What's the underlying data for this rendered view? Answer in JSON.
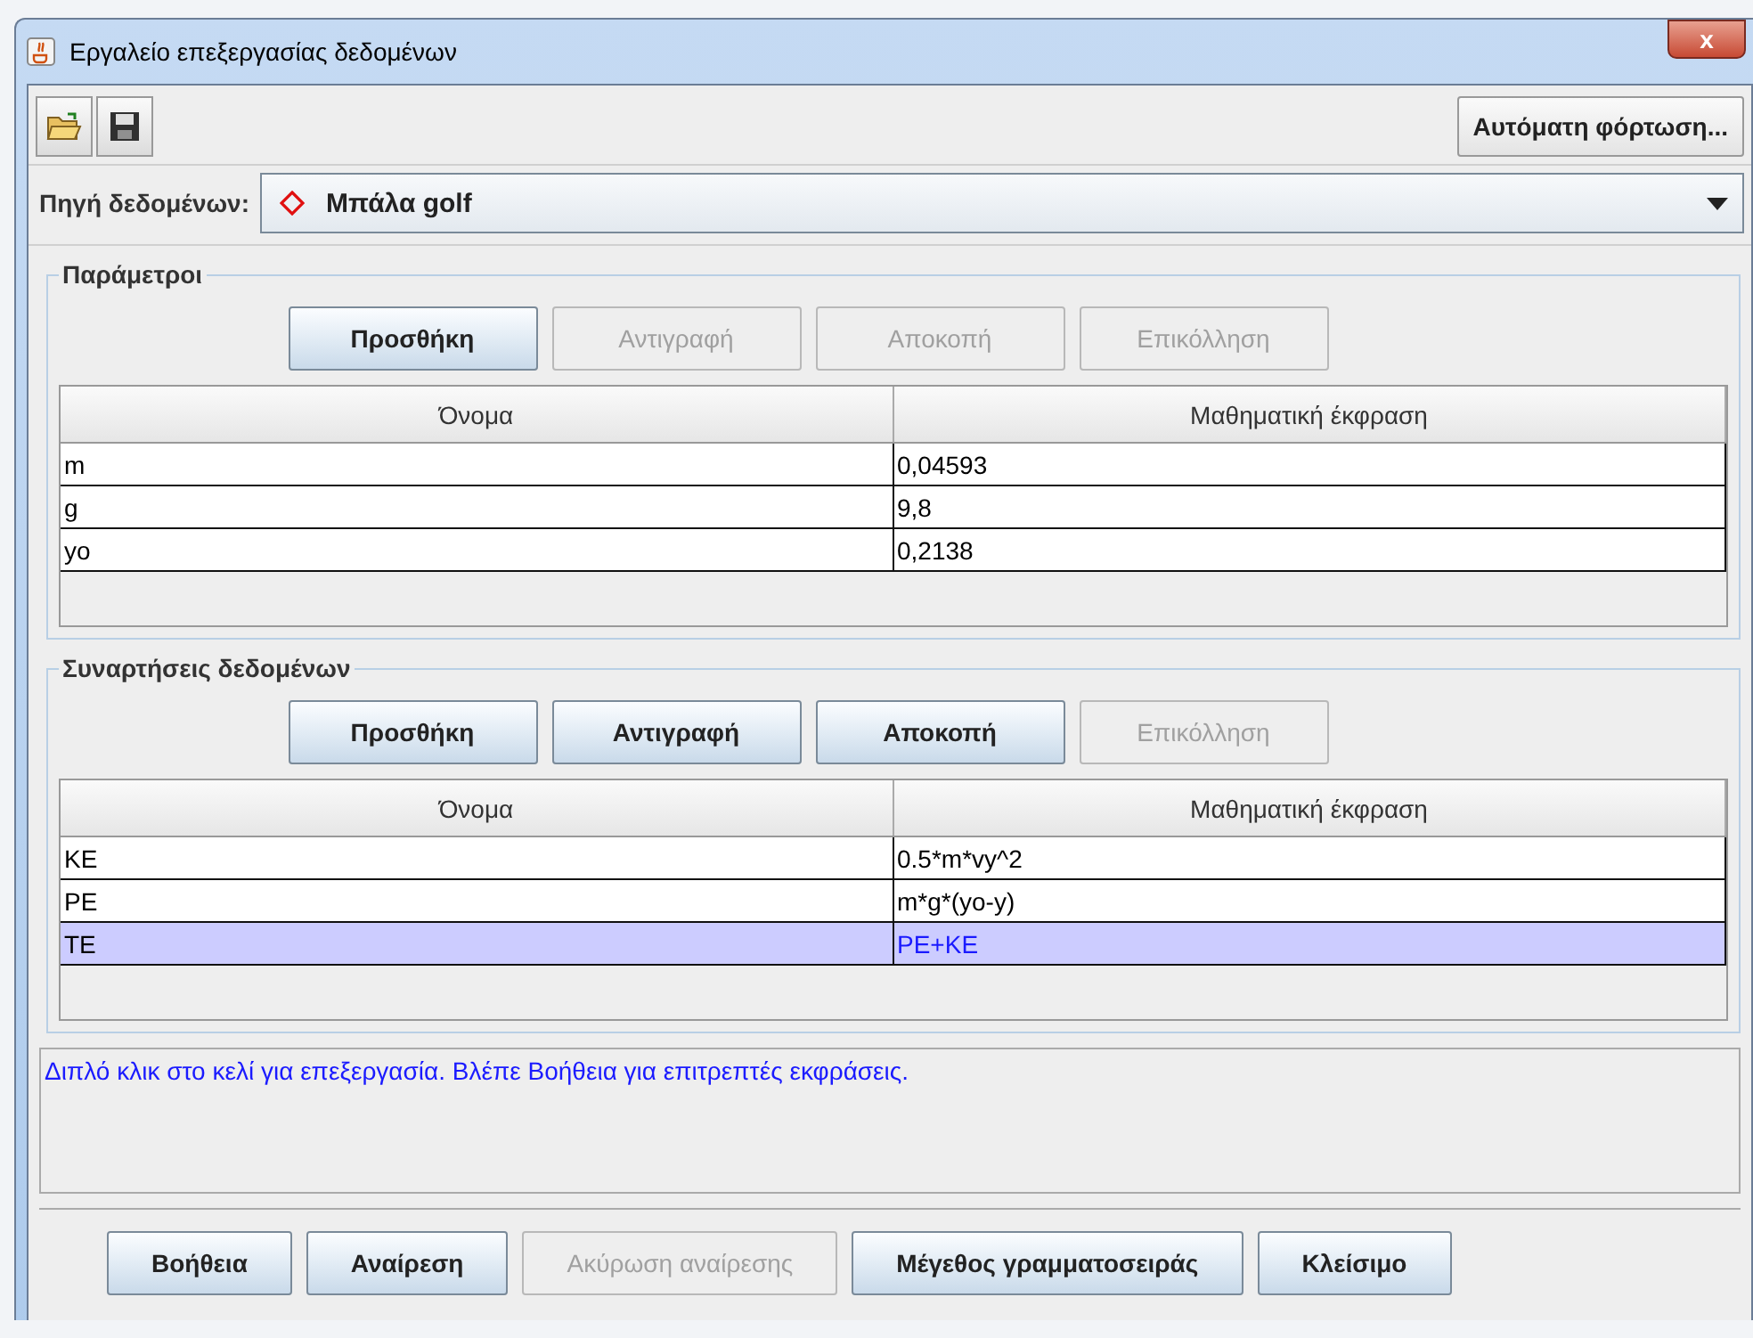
{
  "window": {
    "title": "Εργαλείο επεξεργασίας δεδομένων",
    "close": "x"
  },
  "auto_load_button": "Αυτόματη φόρτωση...",
  "data_source": {
    "label": "Πηγή δεδομένων:",
    "value": "Μπάλα golf"
  },
  "sections": [
    {
      "title": "Παράμετροι",
      "buttons": [
        {
          "label": "Προσθήκη",
          "disabled": false
        },
        {
          "label": "Αντιγραφή",
          "disabled": true
        },
        {
          "label": "Αποκοπή",
          "disabled": true
        },
        {
          "label": "Επικόλληση",
          "disabled": true
        }
      ],
      "columns": [
        "Όνομα",
        "Μαθηματική έκφραση"
      ],
      "rows": [
        {
          "cells": [
            "m",
            "0,04593"
          ],
          "selected": false
        },
        {
          "cells": [
            "g",
            "9,8"
          ],
          "selected": false
        },
        {
          "cells": [
            "yo",
            "0,2138"
          ],
          "selected": false
        }
      ]
    },
    {
      "title": "Συναρτήσεις δεδομένων",
      "buttons": [
        {
          "label": "Προσθήκη",
          "disabled": false
        },
        {
          "label": "Αντιγραφή",
          "disabled": false
        },
        {
          "label": "Αποκοπή",
          "disabled": false
        },
        {
          "label": "Επικόλληση",
          "disabled": true
        }
      ],
      "columns": [
        "Όνομα",
        "Μαθηματική έκφραση"
      ],
      "rows": [
        {
          "cells": [
            "KE",
            "0.5*m*vy^2"
          ],
          "selected": false
        },
        {
          "cells": [
            "PE",
            "m*g*(yo-y)"
          ],
          "selected": false
        },
        {
          "cells": [
            "TE",
            "PE+KE"
          ],
          "selected": true
        }
      ]
    }
  ],
  "hint": "Διπλό κλικ στο κελί για επεξεργασία. Βλέπε Βοήθεια για επιτρεπτές εκφράσεις.",
  "bottom_buttons": [
    {
      "label": "Βοήθεια",
      "disabled": false
    },
    {
      "label": "Αναίρεση",
      "disabled": false
    },
    {
      "label": "Ακύρωση αναίρεσης",
      "disabled": true
    },
    {
      "label": "Μέγεθος γραμματοσειράς",
      "disabled": false
    },
    {
      "label": "Κλείσιμο",
      "disabled": false
    }
  ]
}
